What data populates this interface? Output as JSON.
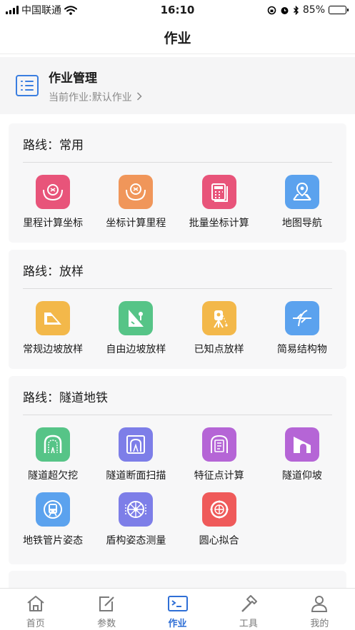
{
  "status_bar": {
    "carrier": "中国联通",
    "time": "16:10",
    "battery": "85%",
    "battery_level": 0.85
  },
  "nav": {
    "title": "作业"
  },
  "job": {
    "title": "作业管理",
    "subtitle": "当前作业:默认作业"
  },
  "sections": [
    {
      "title": "路线：常用",
      "items": [
        {
          "label": "里程计算坐标",
          "color": "#e8547a",
          "icon": "mileage-to-coord-icon"
        },
        {
          "label": "坐标计算里程",
          "color": "#f0965a",
          "icon": "coord-to-mileage-icon"
        },
        {
          "label": "批量坐标计算",
          "color": "#e8547a",
          "icon": "batch-calc-icon"
        },
        {
          "label": "地图导航",
          "color": "#5ba2ee",
          "icon": "map-navigation-icon"
        }
      ]
    },
    {
      "title": "路线：放样",
      "items": [
        {
          "label": "常规边坡放样",
          "color": "#f3b84a",
          "icon": "regular-slope-icon"
        },
        {
          "label": "自由边坡放样",
          "color": "#56c487",
          "icon": "free-slope-icon"
        },
        {
          "label": "已知点放样",
          "color": "#f3b84a",
          "icon": "known-point-icon"
        },
        {
          "label": "简易结构物",
          "color": "#5ba2ee",
          "icon": "simple-structure-icon"
        }
      ]
    },
    {
      "title": "路线：隧道地铁",
      "items": [
        {
          "label": "隧道超欠挖",
          "color": "#56c487",
          "icon": "tunnel-overbreak-icon"
        },
        {
          "label": "隧道断面扫描",
          "color": "#7d7ee8",
          "icon": "tunnel-section-scan-icon"
        },
        {
          "label": "特征点计算",
          "color": "#b565d6",
          "icon": "feature-point-icon"
        },
        {
          "label": "隧道仰坡",
          "color": "#b565d6",
          "icon": "tunnel-slope-icon"
        },
        {
          "label": "地铁管片姿态",
          "color": "#5ba2ee",
          "icon": "metro-segment-icon"
        },
        {
          "label": "盾构姿态测量",
          "color": "#7d7ee8",
          "icon": "shield-attitude-icon"
        },
        {
          "label": "圆心拟合",
          "color": "#ef5a5a",
          "icon": "circle-fit-icon"
        }
      ]
    }
  ],
  "tabs": [
    {
      "label": "首页",
      "icon": "home-icon",
      "active": false
    },
    {
      "label": "参数",
      "icon": "edit-icon",
      "active": false
    },
    {
      "label": "作业",
      "icon": "terminal-icon",
      "active": true
    },
    {
      "label": "工具",
      "icon": "hammer-icon",
      "active": false
    },
    {
      "label": "我的",
      "icon": "user-icon",
      "active": false
    }
  ],
  "accent_color": "#2f6fd6"
}
